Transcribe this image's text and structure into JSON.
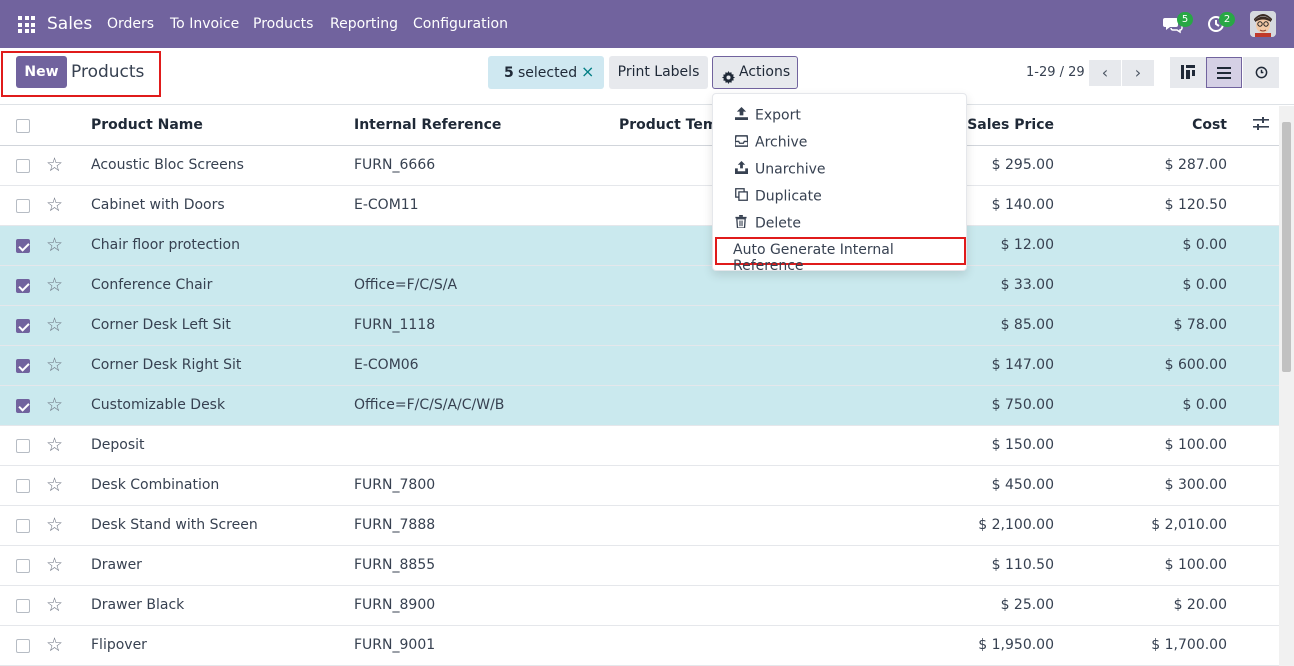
{
  "nav": {
    "app_name": "Sales",
    "menus": [
      "Orders",
      "To Invoice",
      "Products",
      "Reporting",
      "Configuration"
    ],
    "chat_badge": "5",
    "activity_badge": "2",
    "icons": {
      "apps": "apps-grid-icon",
      "chat": "chat-icon",
      "activity": "clock-icon"
    }
  },
  "control": {
    "new_label": "New",
    "title": "Products",
    "selected_count": "5",
    "selected_text": "selected",
    "clear_selection": "×",
    "print_labels": "Print Labels",
    "actions_label": "Actions",
    "pager": "1-29 / 29"
  },
  "actions_menu": {
    "items": [
      "Export",
      "Archive",
      "Unarchive",
      "Duplicate",
      "Delete",
      "Auto Generate Internal Reference"
    ]
  },
  "table": {
    "headers": {
      "name": "Product Name",
      "ref": "Internal Reference",
      "template": "Product Templ",
      "price": "Sales Price",
      "cost": "Cost"
    },
    "rows": [
      {
        "name": "Acoustic Bloc Screens",
        "ref": "FURN_6666",
        "price": "$ 295.00",
        "cost": "$ 287.00",
        "selected": false
      },
      {
        "name": "Cabinet with Doors",
        "ref": "E-COM11",
        "price": "$ 140.00",
        "cost": "$ 120.50",
        "selected": false
      },
      {
        "name": "Chair floor protection",
        "ref": "",
        "price": "$ 12.00",
        "cost": "$ 0.00",
        "selected": true
      },
      {
        "name": "Conference Chair",
        "ref": "Office=F/C/S/A",
        "price": "$ 33.00",
        "cost": "$ 0.00",
        "selected": true
      },
      {
        "name": "Corner Desk Left Sit",
        "ref": "FURN_1118",
        "price": "$ 85.00",
        "cost": "$ 78.00",
        "selected": true
      },
      {
        "name": "Corner Desk Right Sit",
        "ref": "E-COM06",
        "price": "$ 147.00",
        "cost": "$ 600.00",
        "selected": true
      },
      {
        "name": "Customizable Desk",
        "ref": "Office=F/C/S/A/C/W/B",
        "price": "$ 750.00",
        "cost": "$ 0.00",
        "selected": true
      },
      {
        "name": "Deposit",
        "ref": "",
        "price": "$ 150.00",
        "cost": "$ 100.00",
        "selected": false
      },
      {
        "name": "Desk Combination",
        "ref": "FURN_7800",
        "price": "$ 450.00",
        "cost": "$ 300.00",
        "selected": false
      },
      {
        "name": "Desk Stand with Screen",
        "ref": "FURN_7888",
        "price": "$ 2,100.00",
        "cost": "$ 2,010.00",
        "selected": false
      },
      {
        "name": "Drawer",
        "ref": "FURN_8855",
        "price": "$ 110.50",
        "cost": "$ 100.00",
        "selected": false
      },
      {
        "name": "Drawer Black",
        "ref": "FURN_8900",
        "price": "$ 25.00",
        "cost": "$ 20.00",
        "selected": false
      },
      {
        "name": "Flipover",
        "ref": "FURN_9001",
        "price": "$ 1,950.00",
        "cost": "$ 1,700.00",
        "selected": false
      }
    ]
  },
  "colors": {
    "brand": "#71639e",
    "selected_row": "#cae9ee",
    "highlight": "#e01b1b"
  }
}
